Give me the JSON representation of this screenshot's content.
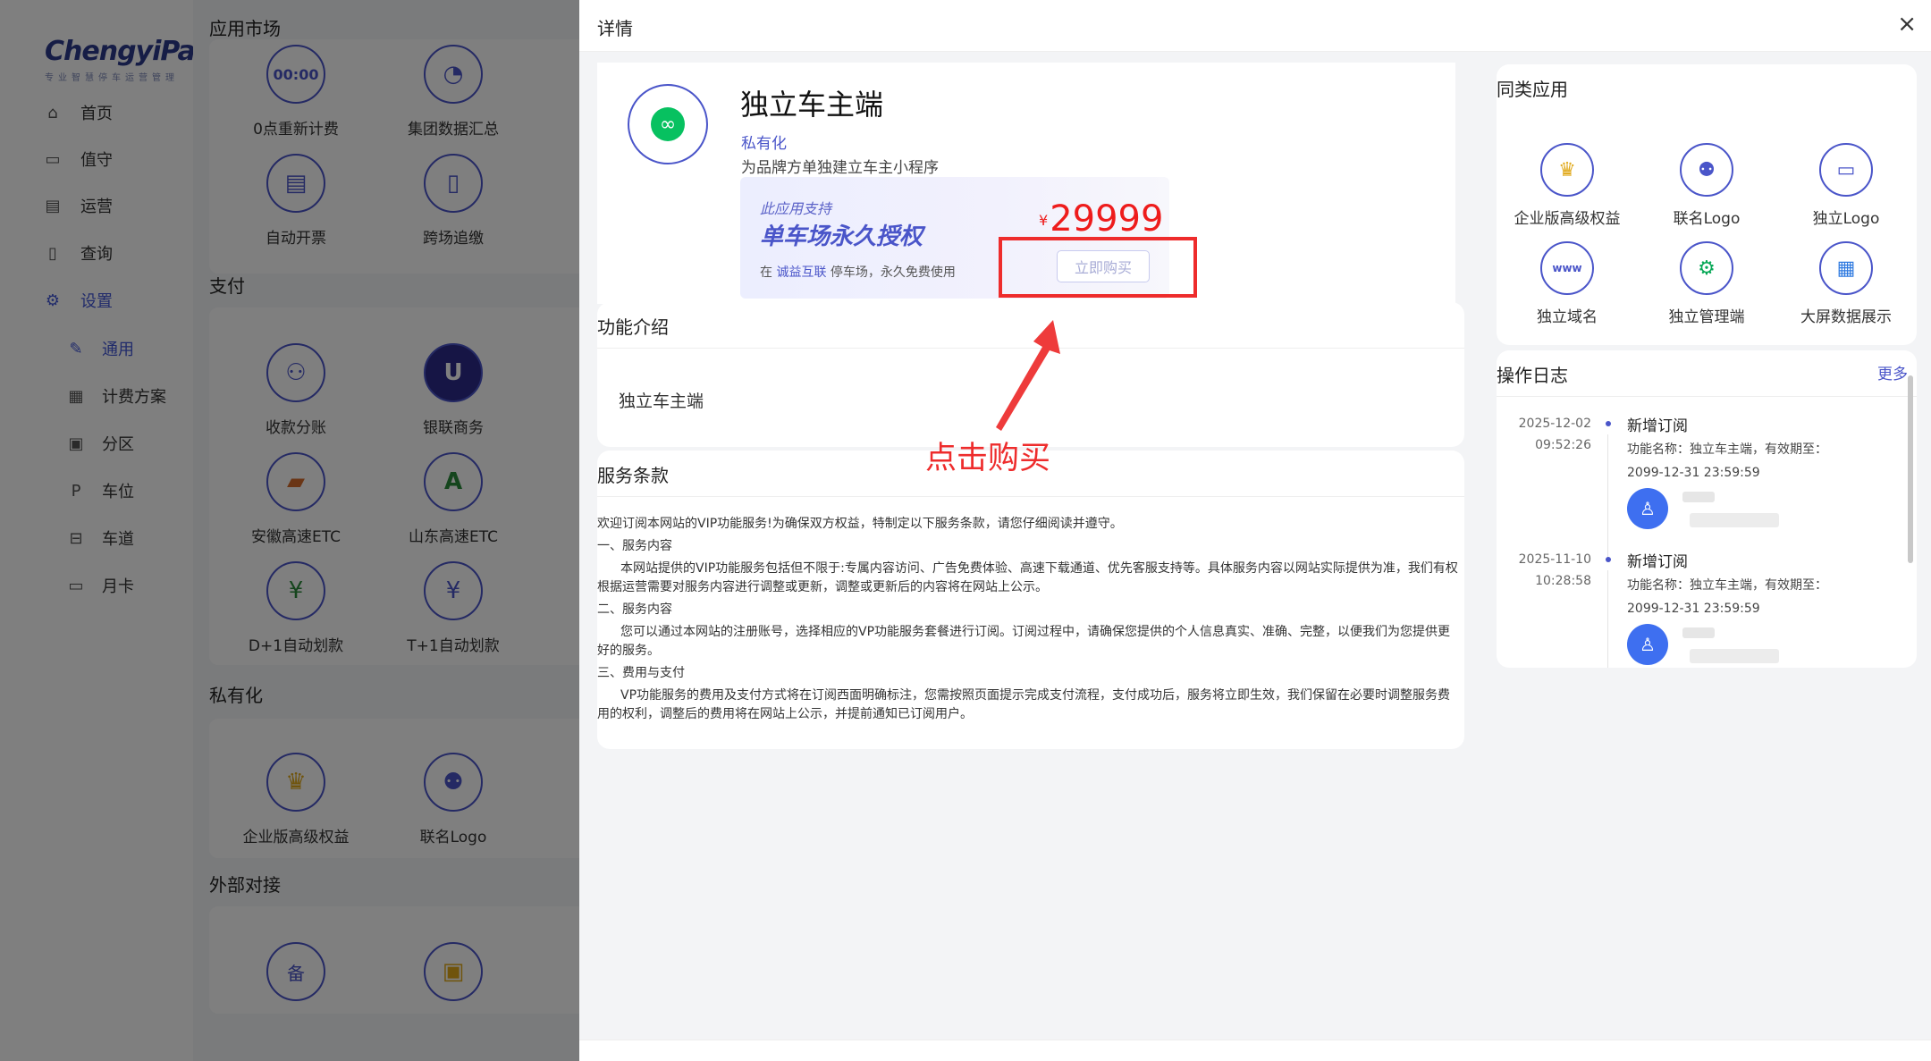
{
  "sidebar": {
    "logo": "ChengyiPark",
    "logo_sub": "专业智慧停车运营管理",
    "items": [
      {
        "label": "首页",
        "icon": "home-icon"
      },
      {
        "label": "值守",
        "icon": "monitor-icon"
      },
      {
        "label": "运营",
        "icon": "document-icon"
      },
      {
        "label": "查询",
        "icon": "search-doc-icon"
      },
      {
        "label": "设置",
        "icon": "gear-icon"
      },
      {
        "label": "通用",
        "icon": "wrench-icon"
      },
      {
        "label": "计费方案",
        "icon": "grid-icon"
      },
      {
        "label": "分区",
        "icon": "zone-icon"
      },
      {
        "label": "车位",
        "icon": "parking-icon"
      },
      {
        "label": "车道",
        "icon": "lane-icon"
      },
      {
        "label": "月卡",
        "icon": "card-icon"
      }
    ]
  },
  "market": {
    "title": "应用市场",
    "sections": [
      {
        "title": "支付"
      },
      {
        "title": "私有化"
      },
      {
        "title": "外部对接"
      }
    ],
    "apps": [
      {
        "label": "0点重新计费",
        "glyph": "00:00"
      },
      {
        "label": "集团数据汇总",
        "glyph": "◔"
      },
      {
        "label": "自动开票",
        "glyph": "▤"
      },
      {
        "label": "跨场追缴",
        "glyph": "▯"
      },
      {
        "label": "收款分账",
        "glyph": "⚇"
      },
      {
        "label": "银联商务",
        "glyph": "U"
      },
      {
        "label": "安徽高速ETC",
        "glyph": "▰"
      },
      {
        "label": "山东高速ETC",
        "glyph": "A"
      },
      {
        "label": "D+1自动划款",
        "glyph": "¥"
      },
      {
        "label": "T+1自动划款",
        "glyph": "¥"
      },
      {
        "label": "企业版高级权益",
        "glyph": "♛"
      },
      {
        "label": "联名Logo",
        "glyph": "⚉"
      },
      {
        "label": "",
        "glyph": "备"
      },
      {
        "label": "",
        "glyph": "▣"
      }
    ]
  },
  "drawer": {
    "title": "详情",
    "close": "×",
    "product": {
      "name": "独立车主端",
      "tag": "私有化",
      "desc": "为品牌方单独建立车主小程序",
      "promo_small": "此应用支持",
      "promo_big": "单车场永久授权",
      "promo_note_prefix": "在",
      "promo_note_link": "诚益互联",
      "promo_note_suffix": "停车场，永久免费使用",
      "currency": "¥",
      "price": "29999",
      "buy_label": "立即购买"
    },
    "intro": {
      "title": "功能介绍",
      "text": "独立车主端"
    },
    "terms": {
      "title": "服务条款",
      "paragraphs": [
        "欢迎订阅本网站的VIP功能服务!为确保双方权益，特制定以下服务条款，请您仔细阅读并遵守。",
        "一、服务内容",
        "本网站提供的VIP功能服务包括但不限于:专属内容访问、广告免费体验、高速下载通道、优先客服支持等。具体服务内容以网站实际提供为准，我们有权根据运营需要对服务内容进行调整或更新，调整或更新后的内容将在网站上公示。",
        "二、服务内容",
        "您可以通过本网站的注册账号，选择相应的VP功能服务套餐进行订阅。订阅过程中，请确保您提供的个人信息真实、准确、完整，以便我们为您提供更好的服务。",
        "三、费用与支付",
        "VP功能服务的费用及支付方式将在订阅西面明确标注，您需按照页面提示完成支付流程，支付成功后，服务将立即生效，我们保留在必要时调整服务费用的权利，调整后的费用将在网站上公示，并提前通知已订阅用户。"
      ]
    },
    "annotation": "点击购买",
    "similar": {
      "title": "同类应用",
      "items": [
        {
          "label": "企业版高级权益",
          "glyph": "♛"
        },
        {
          "label": "联名Logo",
          "glyph": "⚉"
        },
        {
          "label": "独立Logo",
          "glyph": "▭"
        },
        {
          "label": "独立域名",
          "glyph": "www"
        },
        {
          "label": "独立管理端",
          "glyph": "⚙"
        },
        {
          "label": "大屏数据展示",
          "glyph": "▦"
        }
      ]
    },
    "oplog": {
      "title": "操作日志",
      "more": "更多",
      "entries": [
        {
          "date": "2025-12-02",
          "time": "09:52:26",
          "title": "新增订阅",
          "detail1": "功能名称：独立车主端，有效期至：",
          "detail2": "2099-12-31 23:59:59"
        },
        {
          "date": "2025-11-10",
          "time": "10:28:58",
          "title": "新增订阅",
          "detail1": "功能名称：独立车主端，有效期至：",
          "detail2": "2099-12-31 23:59:59"
        }
      ]
    }
  },
  "colors": {
    "accent": "#4a55c9",
    "price": "#ee1c1c",
    "annotation": "#ee2c2c",
    "avatar": "#3e6ff0"
  }
}
